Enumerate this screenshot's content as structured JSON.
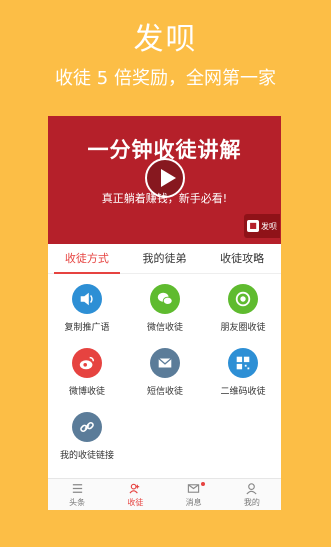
{
  "promo": {
    "title": "发呗",
    "subtitle": "收徒 5 倍奖励，全网第一家"
  },
  "banner": {
    "headline": "一分钟收徒讲解",
    "tagline": "真正躺着赚钱，新手必看!",
    "brand": "发呗"
  },
  "tabs": [
    {
      "label": "收徒方式"
    },
    {
      "label": "我的徒弟"
    },
    {
      "label": "收徒攻略"
    }
  ],
  "share_options": [
    {
      "label": "复制推广语",
      "icon": "speaker-icon",
      "color": "#2d8fd5"
    },
    {
      "label": "微信收徒",
      "icon": "wechat-icon",
      "color": "#5fbb2f"
    },
    {
      "label": "朋友圈收徒",
      "icon": "moments-icon",
      "color": "#5fbb2f"
    },
    {
      "label": "微博收徒",
      "icon": "weibo-icon",
      "color": "#e64340"
    },
    {
      "label": "短信收徒",
      "icon": "message-icon",
      "color": "#5b7c99"
    },
    {
      "label": "二维码收徒",
      "icon": "qrcode-icon",
      "color": "#2d8fd5"
    },
    {
      "label": "我的收徒链接",
      "icon": "link-icon",
      "color": "#5b7c99"
    }
  ],
  "bottom_nav": [
    {
      "label": "头条",
      "icon": "list-icon"
    },
    {
      "label": "收徒",
      "icon": "disciple-icon"
    },
    {
      "label": "消息",
      "icon": "mail-icon"
    },
    {
      "label": "我的",
      "icon": "user-icon"
    }
  ],
  "colors": {
    "background": "#fcbe46",
    "banner": "#b5202a",
    "accent": "#e64340"
  }
}
